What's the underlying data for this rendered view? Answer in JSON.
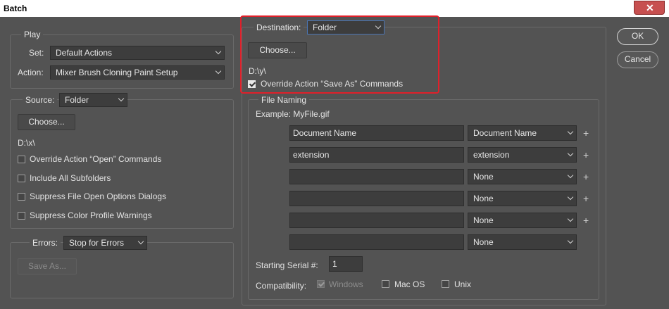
{
  "window": {
    "title": "Batch"
  },
  "colors": {
    "background": "#535353",
    "highlight": "#e0202a",
    "active_border": "#4a76b6"
  },
  "play": {
    "legend": "Play",
    "set_label": "Set:",
    "set_value": "Default Actions",
    "action_label": "Action:",
    "action_value": "Mixer Brush Cloning Paint Setup"
  },
  "source": {
    "label": "Source:",
    "value": "Folder",
    "choose_label": "Choose...",
    "path": "D:\\x\\",
    "options": [
      {
        "label": "Override Action “Open” Commands",
        "checked": false
      },
      {
        "label": "Include All Subfolders",
        "checked": false
      },
      {
        "label": "Suppress File Open Options Dialogs",
        "checked": false
      },
      {
        "label": "Suppress Color Profile Warnings",
        "checked": false
      }
    ]
  },
  "errors": {
    "label": "Errors:",
    "value": "Stop for Errors",
    "save_as_label": "Save As..."
  },
  "destination": {
    "label": "Destination:",
    "value": "Folder",
    "choose_label": "Choose...",
    "path": "D:\\y\\",
    "override_label": "Override Action “Save As” Commands",
    "override_checked": true
  },
  "file_naming": {
    "legend": "File Naming",
    "example": "Example: MyFile.gif",
    "rows": [
      {
        "text": "Document Name",
        "select": "Document Name",
        "plus": "+"
      },
      {
        "text": "extension",
        "select": "extension",
        "plus": "+"
      },
      {
        "text": "",
        "select": "None",
        "plus": "+"
      },
      {
        "text": "",
        "select": "None",
        "plus": "+"
      },
      {
        "text": "",
        "select": "None",
        "plus": "+"
      },
      {
        "text": "",
        "select": "None",
        "plus": ""
      }
    ],
    "serial_label": "Starting Serial #:",
    "serial_value": "1",
    "compat_label": "Compatibility:",
    "compat": [
      {
        "label": "Windows",
        "checked": true,
        "disabled": true
      },
      {
        "label": "Mac OS",
        "checked": false,
        "disabled": false
      },
      {
        "label": "Unix",
        "checked": false,
        "disabled": false
      }
    ]
  },
  "buttons": {
    "ok": "OK",
    "cancel": "Cancel"
  }
}
